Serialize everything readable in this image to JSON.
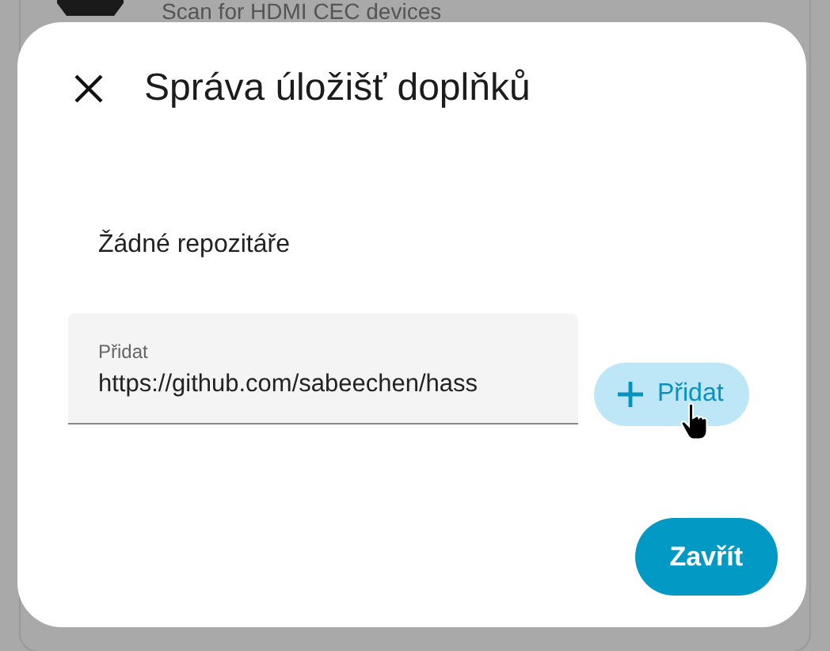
{
  "background": {
    "card_subtitle": "Scan for HDMI CEC devices"
  },
  "dialog": {
    "title": "Správa úložišť doplňků",
    "empty_message": "Žádné repozitáře",
    "field": {
      "label": "Přidat",
      "value": "https://github.com/sabeechen/hass"
    },
    "add_button": "Přidat",
    "close_button": "Zavřít"
  }
}
